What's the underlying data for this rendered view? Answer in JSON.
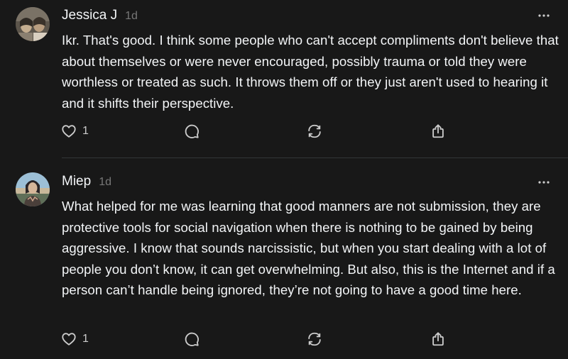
{
  "posts": [
    {
      "author": "Jessica J",
      "time": "1d",
      "text": "Ikr. That's good. I think some people who can't accept compliments don't believe that about themselves or were never encouraged, possibly trauma or told they were worthless or treated as such. It throws them off or they just aren't used to hearing it and it shifts their perspective.",
      "like_count": "1",
      "avatar_colors": [
        "#6b6355",
        "#c9b9a3",
        "#3a342d"
      ]
    },
    {
      "author": "Miep",
      "time": "1d",
      "text": "What helped for me was learning that good manners are not submission, they are protective tools for social navigation when there is nothing to be gained by being aggressive. I know that sounds narcissistic, but when you start dealing with a lot of people you don’t know, it can get overwhelming. But also, this is the Internet and if a person can’t handle being ignored, they’re not going to have a good time here.",
      "like_count": "1",
      "avatar_colors": [
        "#8fb3c9",
        "#2b2a2e",
        "#d8c3a8"
      ]
    }
  ],
  "icons": {
    "more": "more-icon",
    "like": "heart-icon",
    "reply": "comment-icon",
    "repost": "repost-icon",
    "share": "share-icon"
  },
  "colors": {
    "background": "#181818",
    "text": "#f3f5f7",
    "muted": "#777777",
    "icon": "#cccccc",
    "divider": "#333638"
  }
}
